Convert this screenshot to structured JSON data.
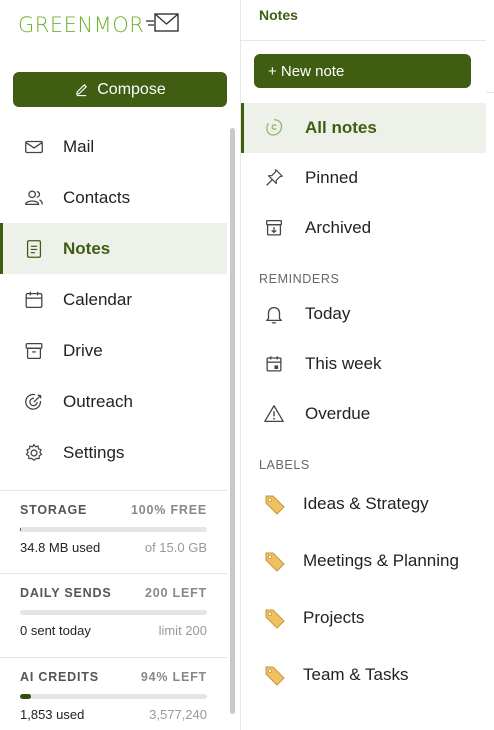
{
  "brand": {
    "name": "GREENMOR"
  },
  "compose": {
    "label": "Compose"
  },
  "nav": [
    {
      "label": "Mail",
      "icon": "mail-icon"
    },
    {
      "label": "Contacts",
      "icon": "contacts-icon"
    },
    {
      "label": "Notes",
      "icon": "notes-icon",
      "active": true
    },
    {
      "label": "Calendar",
      "icon": "calendar-icon"
    },
    {
      "label": "Drive",
      "icon": "drive-icon"
    },
    {
      "label": "Outreach",
      "icon": "outreach-icon"
    },
    {
      "label": "Settings",
      "icon": "gear-icon"
    }
  ],
  "quotas": {
    "storage": {
      "title": "STORAGE",
      "status": "100% FREE",
      "used": "34.8 MB used",
      "limit": "of 15.0 GB",
      "fill": 0.002
    },
    "sends": {
      "title": "DAILY SENDS",
      "status": "200 LEFT",
      "used": "0 sent today",
      "limit": "limit 200",
      "fill": 0.0
    },
    "credits": {
      "title": "AI CREDITS",
      "status": "94% LEFT",
      "used": "1,853 used",
      "limit": "3,577,240",
      "fill": 0.06
    }
  },
  "notes_panel": {
    "title": "Notes",
    "new_note": "+ New note",
    "views": [
      {
        "label": "All notes",
        "icon": "all-notes-icon",
        "active": true
      },
      {
        "label": "Pinned",
        "icon": "pin-icon"
      },
      {
        "label": "Archived",
        "icon": "archive-icon"
      }
    ],
    "reminders_heading": "REMINDERS",
    "reminders": [
      {
        "label": "Today",
        "icon": "bell-icon"
      },
      {
        "label": "This week",
        "icon": "calendar-week-icon"
      },
      {
        "label": "Overdue",
        "icon": "warning-icon"
      }
    ],
    "labels_heading": "LABELS",
    "labels": [
      {
        "label": "Ideas & Strategy",
        "icon": "tag-icon"
      },
      {
        "label": "Meetings & Planning",
        "icon": "tag-icon"
      },
      {
        "label": "Projects",
        "icon": "tag-icon"
      },
      {
        "label": "Team & Tasks",
        "icon": "tag-icon"
      }
    ]
  },
  "colors": {
    "accent": "#3f5e12",
    "brand": "#6ab42a",
    "active_bg": "#eef1ea"
  }
}
